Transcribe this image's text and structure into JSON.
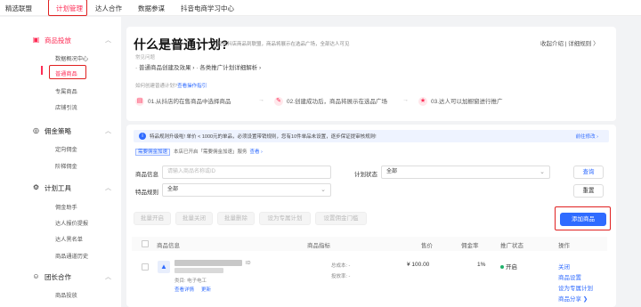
{
  "topnav": {
    "items": [
      "精选联盟",
      "计划管理",
      "达人合作",
      "数据参谋",
      "抖音电商学习中心"
    ],
    "active_index": 1
  },
  "sidebar": {
    "sections": [
      {
        "title": "商品投放",
        "items": [
          "数据概况中心",
          "普通商品",
          "专属商品",
          "店铺引流"
        ]
      },
      {
        "title": "佣金策略",
        "items": [
          "定向佣金",
          "阶梯佣金"
        ]
      },
      {
        "title": "计划工具",
        "items": [
          "佣金助手",
          "达人报价提报",
          "达人黑名单",
          "商品通道历史"
        ]
      },
      {
        "title": "团长合作",
        "items": [
          "商品投放"
        ]
      }
    ],
    "active_item": "普通商品"
  },
  "header": {
    "title": "什么是普通计划?",
    "subtitle": "投放抖店商品到联盟，商品将展示在选品广场，全部达人可见",
    "links": "收起介绍 | 详细规则 〉"
  },
  "faq": {
    "title": "常见问题",
    "items": "· 普通商品创建及效果 ›      · 各类推广计划详细解析 ›"
  },
  "howto": {
    "text": "如何创建普通计划?",
    "link": "查看操作指引"
  },
  "steps": [
    "01.从抖店的在售商品中选择商品",
    "02.创建成功后，商品将展示在选品广场",
    "03.达人可以加橱窗进行推广"
  ],
  "notice": {
    "text": "特品规则升级啦! 单价 < 1000元的单品，必须设置带销规则，您有10件单品未设置，逐步保证提审核规则!",
    "link": "前往修改 ›"
  },
  "promo": {
    "tag": "需要佣金加速",
    "text": "本店已开启「需要佣金加速」服务",
    "link": "查看 ›"
  },
  "filters": {
    "product_label": "商品信息",
    "product_placeholder": "请输入商品名称或ID",
    "status_label": "计划状态",
    "status_value": "全部",
    "rule_label": "特品规则",
    "rule_value": "全部",
    "search_button": "查询",
    "reset_button": "重置"
  },
  "actions": {
    "batch": [
      "批量开启",
      "批量关闭",
      "批量删除",
      "设为专属计划",
      "设置佣金门槛"
    ],
    "add_button": "添加商品"
  },
  "table": {
    "headers": [
      "商品信息",
      "商品指标",
      "售价",
      "佣金率",
      "推广状态",
      "操作"
    ],
    "rows": [
      {
        "id_suffix": "ID",
        "category": "类目: 电子电工",
        "tag1": "查看详情",
        "tag2": "更新",
        "metric1": "总成本: -",
        "metric2": "投放率: -",
        "price": "¥ 100.00",
        "rate": "1%",
        "status": "开启",
        "ops": [
          "关闭",
          "商品设置",
          "设为专属计划",
          "商品分享 ❯"
        ]
      }
    ]
  },
  "colors": {
    "accent": "#fe2c55",
    "link": "#2f6bff",
    "highlight_box": "#e02020"
  }
}
